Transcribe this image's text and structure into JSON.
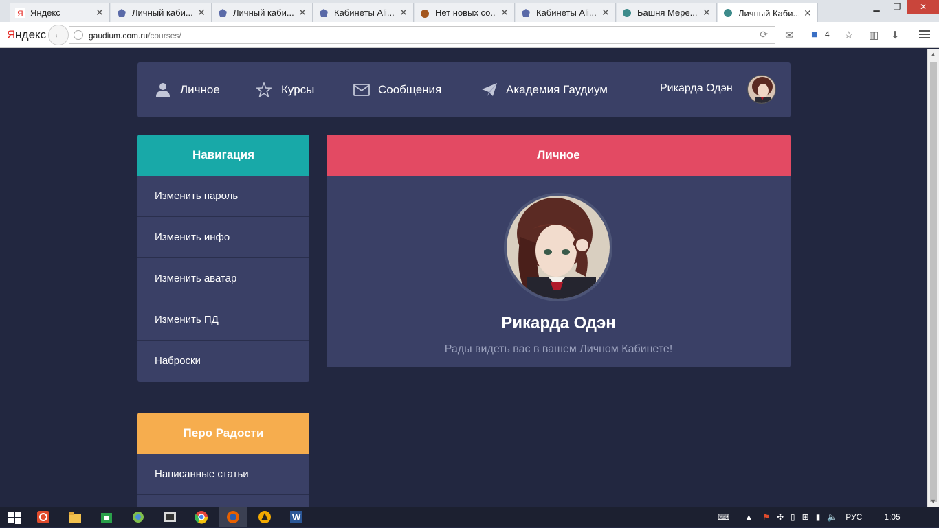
{
  "browser": {
    "tabs": [
      {
        "label": "Яндекс"
      },
      {
        "label": "Личный каби..."
      },
      {
        "label": "Личный каби..."
      },
      {
        "label": "Кабинеты Ali..."
      },
      {
        "label": "Нет новых со..."
      },
      {
        "label": "Кабинеты Ali..."
      },
      {
        "label": "Башня Мере..."
      },
      {
        "label": "Личный Каби..."
      }
    ],
    "logo": "ндекс",
    "logo_first": "Я",
    "url_host": "gaudium.com.ru",
    "url_path": "/courses/",
    "toolbar_count": "4"
  },
  "topnav": {
    "items": [
      {
        "label": "Личное",
        "icon": "user-icon"
      },
      {
        "label": "Курсы",
        "icon": "star-icon"
      },
      {
        "label": "Сообщения",
        "icon": "envelope-icon"
      },
      {
        "label": "Академия Гаудиум",
        "icon": "paper-plane-icon"
      }
    ],
    "profile_name": "Рикарда Одэн"
  },
  "sidebar": {
    "title": "Навигация",
    "items": [
      {
        "label": "Изменить пароль"
      },
      {
        "label": "Изменить инфо"
      },
      {
        "label": "Изменить аватар"
      },
      {
        "label": "Изменить ПД"
      },
      {
        "label": "Наброски"
      }
    ]
  },
  "pero": {
    "title": "Перо Радости",
    "items": [
      {
        "label": "Написанные статьи"
      }
    ]
  },
  "main": {
    "title": "Личное",
    "name": "Рикарда Одэн",
    "welcome": "Рады видеть вас в вашем Личном Кабинете!"
  },
  "taskbar": {
    "lang": "РУС",
    "time": "1:05"
  },
  "colors": {
    "page_bg": "#222740",
    "panel_bg": "#3a4066",
    "nav_header": "#18a9a8",
    "main_header": "#e34a63",
    "pero_header": "#f6ad4e"
  }
}
